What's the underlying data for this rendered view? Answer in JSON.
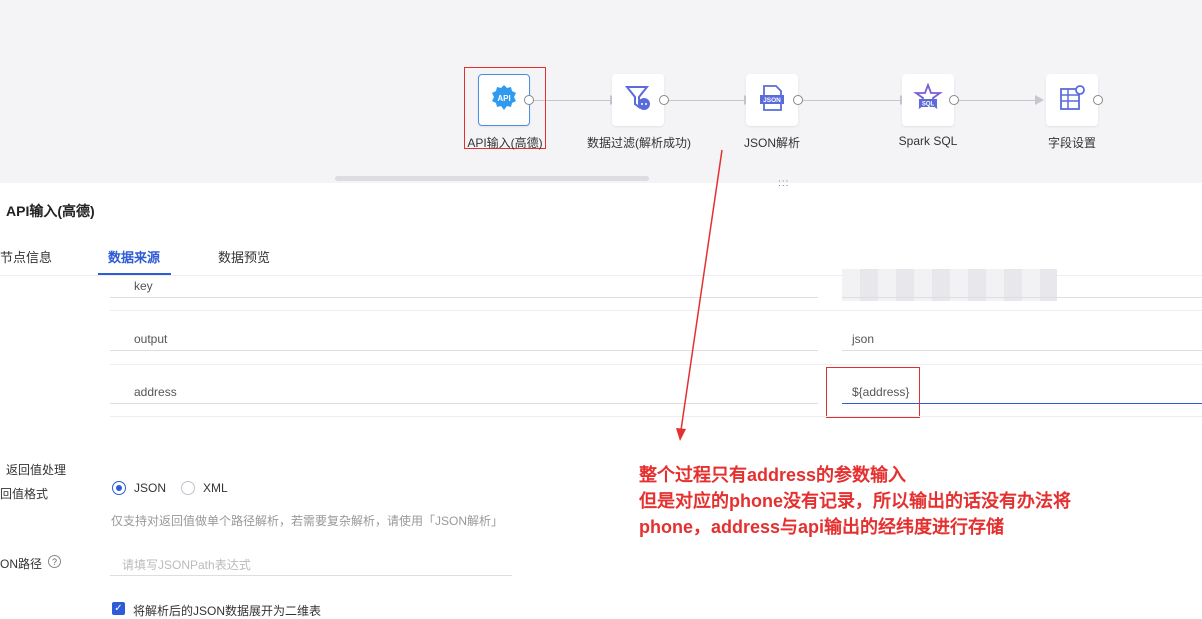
{
  "flow": {
    "nodes": [
      {
        "label": "API输入(高德)",
        "icon": "api-icon"
      },
      {
        "label": "数据过滤(解析成功)",
        "icon": "filter-icon"
      },
      {
        "label": "JSON解析",
        "icon": "json-file-icon"
      },
      {
        "label": "Spark SQL",
        "icon": "sql-icon"
      },
      {
        "label": "字段设置",
        "icon": "field-settings-icon"
      }
    ],
    "api_icon_text": "API",
    "json_icon_text": "JSON",
    "sql_icon_text": "SQL"
  },
  "panel": {
    "title": "API输入(高德)",
    "tabs": [
      "节点信息",
      "数据来源",
      "数据预览"
    ],
    "active_tab": "数据来源"
  },
  "params": [
    {
      "name": "key",
      "value": ""
    },
    {
      "name": "output",
      "value": "json"
    },
    {
      "name": "address",
      "value": "${address}"
    }
  ],
  "response": {
    "handling_label": "返回值处理",
    "format_label": "回值格式",
    "formats": [
      "JSON",
      "XML"
    ],
    "selected_format": "JSON",
    "hint": "仅支持对返回值做单个路径解析，若需要复杂解析，请使用「JSON解析」",
    "path_label": "ON路径",
    "path_help": "?",
    "path_placeholder": "请填写JSONPath表达式",
    "flatten_label": "将解析后的JSON数据展开为二维表",
    "flatten_checked": true
  },
  "annotation": {
    "lines": [
      "整个过程只有address的参数输入",
      "但是对应的phone没有记录，所以输出的话没有办法将",
      "phone，address与api输出的经纬度进行存储"
    ],
    "color": "#e53030"
  },
  "colors": {
    "accent": "#2e5bd7",
    "highlight": "#e03030"
  }
}
